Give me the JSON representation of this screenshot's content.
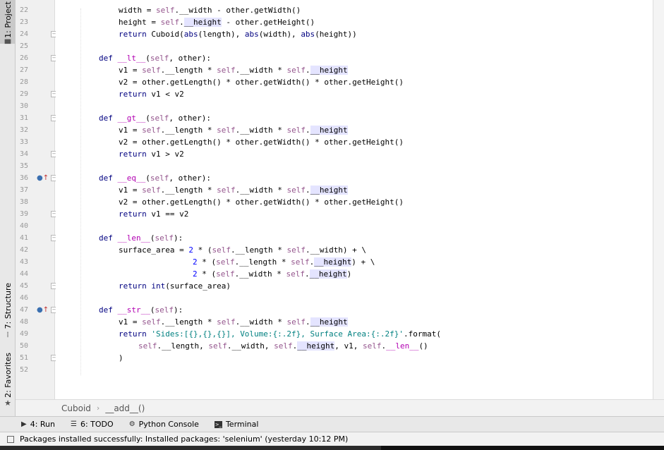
{
  "left_tabs": {
    "project": "1: Project",
    "structure": "7: Structure",
    "favorites": "2: Favorites"
  },
  "lines": [
    {
      "n": "22",
      "indent": 8,
      "tokens": [
        [
          "",
          "width = "
        ],
        [
          "sf",
          "self"
        ],
        [
          "",
          ".__width - other.getWidth()"
        ]
      ]
    },
    {
      "n": "23",
      "indent": 8,
      "tokens": [
        [
          "",
          "height = "
        ],
        [
          "sf",
          "self"
        ],
        [
          "",
          "."
        ],
        [
          "hl",
          "__height"
        ],
        [
          "",
          " - other.getHeight()"
        ]
      ]
    },
    {
      "n": "24",
      "indent": 8,
      "tokens": [
        [
          "kw",
          "return "
        ],
        [
          "",
          "Cuboid("
        ],
        [
          "bi",
          "abs"
        ],
        [
          "",
          "(length), "
        ],
        [
          "bi",
          "abs"
        ],
        [
          "",
          "(width), "
        ],
        [
          "bi",
          "abs"
        ],
        [
          "",
          "(height))"
        ]
      ]
    },
    {
      "n": "25",
      "indent": 0,
      "tokens": []
    },
    {
      "n": "26",
      "indent": 4,
      "tokens": [
        [
          "kw",
          "def "
        ],
        [
          "dn",
          "__lt__"
        ],
        [
          "",
          "("
        ],
        [
          "sf",
          "self"
        ],
        [
          "",
          ", other):"
        ]
      ]
    },
    {
      "n": "27",
      "indent": 8,
      "tokens": [
        [
          "",
          "v1 = "
        ],
        [
          "sf",
          "self"
        ],
        [
          "",
          ".__length * "
        ],
        [
          "sf",
          "self"
        ],
        [
          "",
          ".__width * "
        ],
        [
          "sf",
          "self"
        ],
        [
          "",
          "."
        ],
        [
          "hl",
          "__height"
        ]
      ]
    },
    {
      "n": "28",
      "indent": 8,
      "tokens": [
        [
          "",
          "v2 = other.getLength() * other.getWidth() * other.getHeight()"
        ]
      ]
    },
    {
      "n": "29",
      "indent": 8,
      "tokens": [
        [
          "kw",
          "return "
        ],
        [
          "",
          "v1 < v2"
        ]
      ]
    },
    {
      "n": "30",
      "indent": 0,
      "tokens": []
    },
    {
      "n": "31",
      "indent": 4,
      "tokens": [
        [
          "kw",
          "def "
        ],
        [
          "dn",
          "__gt__"
        ],
        [
          "",
          "("
        ],
        [
          "sf",
          "self"
        ],
        [
          "",
          ", other):"
        ]
      ]
    },
    {
      "n": "32",
      "indent": 8,
      "tokens": [
        [
          "",
          "v1 = "
        ],
        [
          "sf",
          "self"
        ],
        [
          "",
          ".__length * "
        ],
        [
          "sf",
          "self"
        ],
        [
          "",
          ".__width * "
        ],
        [
          "sf",
          "self"
        ],
        [
          "",
          "."
        ],
        [
          "hl",
          "__height"
        ]
      ]
    },
    {
      "n": "33",
      "indent": 8,
      "tokens": [
        [
          "",
          "v2 = other.getLength() * other.getWidth() * other.getHeight()"
        ]
      ]
    },
    {
      "n": "34",
      "indent": 8,
      "tokens": [
        [
          "kw",
          "return "
        ],
        [
          "",
          "v1 > v2"
        ]
      ]
    },
    {
      "n": "35",
      "indent": 0,
      "tokens": []
    },
    {
      "n": "36",
      "indent": 4,
      "tokens": [
        [
          "kw",
          "def "
        ],
        [
          "dn",
          "__eq__"
        ],
        [
          "",
          "("
        ],
        [
          "sf",
          "self"
        ],
        [
          "",
          ", other):"
        ]
      ]
    },
    {
      "n": "37",
      "indent": 8,
      "tokens": [
        [
          "",
          "v1 = "
        ],
        [
          "sf",
          "self"
        ],
        [
          "",
          ".__length * "
        ],
        [
          "sf",
          "self"
        ],
        [
          "",
          ".__width * "
        ],
        [
          "sf",
          "self"
        ],
        [
          "",
          "."
        ],
        [
          "hl",
          "__height"
        ]
      ]
    },
    {
      "n": "38",
      "indent": 8,
      "tokens": [
        [
          "",
          "v2 = other.getLength() * other.getWidth() * other.getHeight()"
        ]
      ]
    },
    {
      "n": "39",
      "indent": 8,
      "tokens": [
        [
          "kw",
          "return "
        ],
        [
          "",
          "v1 == v2"
        ]
      ]
    },
    {
      "n": "40",
      "indent": 0,
      "tokens": []
    },
    {
      "n": "41",
      "indent": 4,
      "tokens": [
        [
          "kw",
          "def "
        ],
        [
          "dn",
          "__len__"
        ],
        [
          "",
          "("
        ],
        [
          "sf",
          "self"
        ],
        [
          "",
          "):"
        ]
      ]
    },
    {
      "n": "42",
      "indent": 8,
      "tokens": [
        [
          "",
          "surface_area = "
        ],
        [
          "nm",
          "2"
        ],
        [
          "",
          " * ("
        ],
        [
          "sf",
          "self"
        ],
        [
          "",
          ".__length * "
        ],
        [
          "sf",
          "self"
        ],
        [
          "",
          ".__width) + \\"
        ]
      ]
    },
    {
      "n": "43",
      "indent": 23,
      "tokens": [
        [
          "nm",
          "2"
        ],
        [
          "",
          " * ("
        ],
        [
          "sf",
          "self"
        ],
        [
          "",
          ".__length * "
        ],
        [
          "sf",
          "self"
        ],
        [
          "",
          "."
        ],
        [
          "hl",
          "__height"
        ],
        [
          "",
          ") + \\"
        ]
      ]
    },
    {
      "n": "44",
      "indent": 23,
      "tokens": [
        [
          "nm",
          "2"
        ],
        [
          "",
          " * ("
        ],
        [
          "sf",
          "self"
        ],
        [
          "",
          ".__width * "
        ],
        [
          "sf",
          "self"
        ],
        [
          "",
          "."
        ],
        [
          "hl",
          "__height"
        ],
        [
          "",
          ")"
        ]
      ]
    },
    {
      "n": "45",
      "indent": 8,
      "tokens": [
        [
          "kw",
          "return "
        ],
        [
          "bi",
          "int"
        ],
        [
          "",
          "(surface_area)"
        ]
      ]
    },
    {
      "n": "46",
      "indent": 0,
      "tokens": []
    },
    {
      "n": "47",
      "indent": 4,
      "tokens": [
        [
          "kw",
          "def "
        ],
        [
          "dn",
          "__str__"
        ],
        [
          "",
          "("
        ],
        [
          "sf",
          "self"
        ],
        [
          "",
          "):"
        ]
      ]
    },
    {
      "n": "48",
      "indent": 8,
      "tokens": [
        [
          "",
          "v1 = "
        ],
        [
          "sf",
          "self"
        ],
        [
          "",
          ".__length * "
        ],
        [
          "sf",
          "self"
        ],
        [
          "",
          ".__width * "
        ],
        [
          "sf",
          "self"
        ],
        [
          "",
          "."
        ],
        [
          "hl",
          "__height"
        ]
      ]
    },
    {
      "n": "49",
      "indent": 8,
      "tokens": [
        [
          "kw",
          "return "
        ],
        [
          "st",
          "'Sides:[{},{},{}], Volume:{:.2f}, Surface Area:{:.2f}'"
        ],
        [
          "",
          ".format("
        ]
      ]
    },
    {
      "n": "50",
      "indent": 12,
      "tokens": [
        [
          "sf",
          "self"
        ],
        [
          "",
          ".__length, "
        ],
        [
          "sf",
          "self"
        ],
        [
          "",
          ".__width, "
        ],
        [
          "sf",
          "self"
        ],
        [
          "",
          "."
        ],
        [
          "hl",
          "__height"
        ],
        [
          "",
          ", v1, "
        ],
        [
          "sf",
          "self"
        ],
        [
          "",
          "."
        ],
        [
          "dn",
          "__len__"
        ],
        [
          "",
          "()"
        ]
      ]
    },
    {
      "n": "51",
      "indent": 8,
      "tokens": [
        [
          "",
          ")"
        ]
      ]
    },
    {
      "n": "52",
      "indent": 0,
      "tokens": []
    }
  ],
  "override_lines": [
    "36",
    "47"
  ],
  "fold_lines": [
    "24",
    "26",
    "29",
    "31",
    "34",
    "36",
    "39",
    "41",
    "45",
    "47",
    "51"
  ],
  "breadcrumb": {
    "class_name": "Cuboid",
    "separator": "›",
    "method_name": "__add__()"
  },
  "tool_windows": [
    {
      "icon": "run-icon",
      "glyph": "▶",
      "label": "4: Run"
    },
    {
      "icon": "todo-icon",
      "glyph": "☰",
      "label": "6: TODO"
    },
    {
      "icon": "python-console-icon",
      "glyph": "⚙",
      "label": "Python Console"
    },
    {
      "icon": "terminal-icon",
      "glyph": ">_",
      "label": "Terminal"
    }
  ],
  "status": {
    "message": "Packages installed successfully: Installed packages: 'selenium' (yesterday 10:12 PM)"
  }
}
